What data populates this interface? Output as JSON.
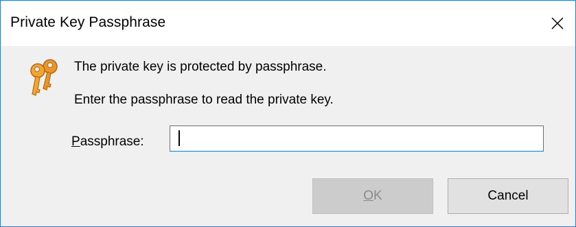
{
  "window": {
    "title": "Private Key Passphrase",
    "close_icon": "close-icon"
  },
  "message": {
    "line1": "The private key is protected by passphrase.",
    "line2": "Enter the passphrase to read the private key.",
    "icon": "keys-icon"
  },
  "passphrase": {
    "label_first": "P",
    "label_rest": "assphrase:",
    "value": "",
    "placeholder": ""
  },
  "buttons": {
    "ok_first": "O",
    "ok_rest": "K",
    "ok_enabled": false,
    "cancel_label": "Cancel"
  },
  "colors": {
    "accent": "#2b79d6",
    "key_gold": "#f2a531"
  }
}
